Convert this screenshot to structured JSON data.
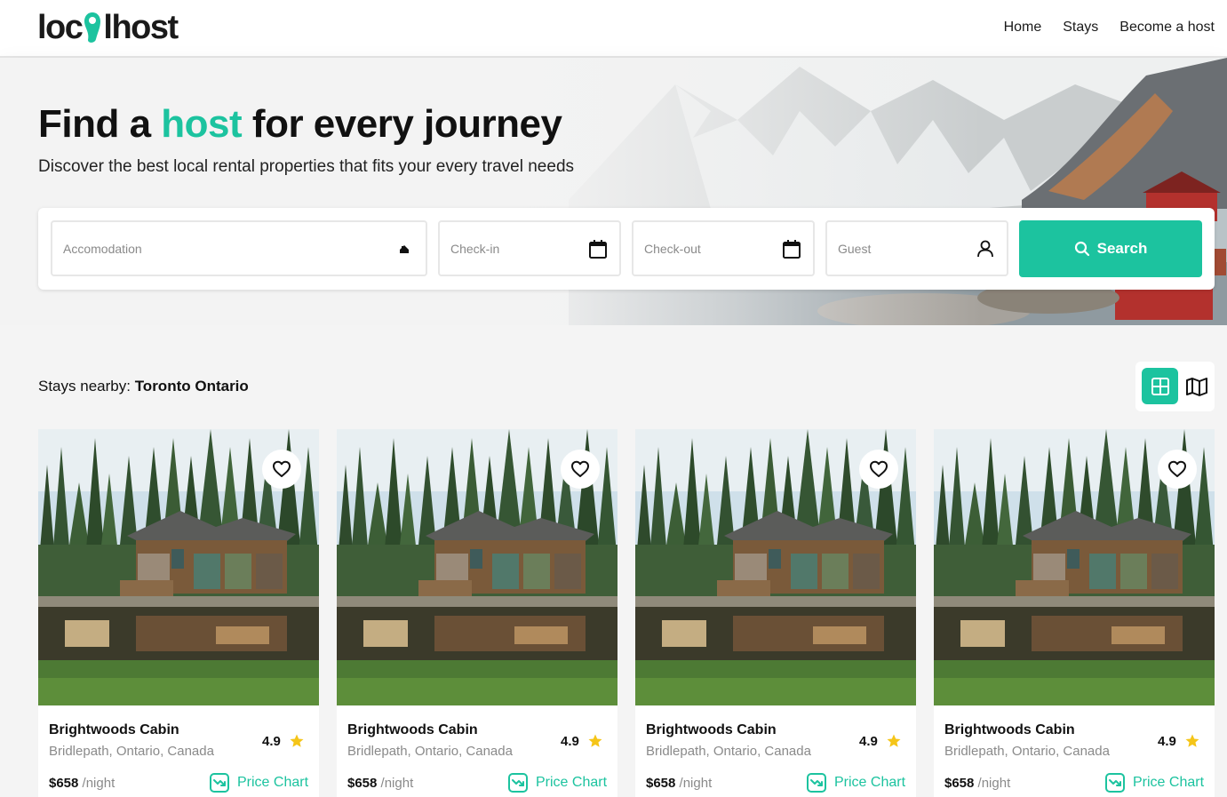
{
  "brand": {
    "logo_text_left": "loc",
    "logo_text_right": "lhost",
    "accent_color": "#1cc39f"
  },
  "nav": {
    "items": [
      {
        "label": "Home"
      },
      {
        "label": "Stays"
      },
      {
        "label": "Become a host"
      }
    ]
  },
  "hero": {
    "headline_pre": "Find a",
    "headline_accent": "host",
    "headline_post": "for every journey",
    "subline": "Discover the best local rental properties that fits your every travel needs"
  },
  "search": {
    "accommodation_placeholder": "Accomodation",
    "checkin_placeholder": "Check-in",
    "checkout_placeholder": "Check-out",
    "guest_placeholder": "Guest",
    "button_label": "Search",
    "icons": {
      "accommodation": "home-icon",
      "checkin": "calendar-icon",
      "checkout": "calendar-icon",
      "guest": "user-icon",
      "button": "search-icon"
    }
  },
  "listing": {
    "nearby_label": "Stays nearby:",
    "nearby_location": "Toronto Ontario",
    "view_toggle": {
      "grid_icon": "grid-icon",
      "map_icon": "map-icon",
      "active": "grid"
    },
    "cards": [
      {
        "name": "Brightwoods Cabin",
        "location": "Bridlepath, Ontario, Canada",
        "rating": "4.9",
        "price": "$658",
        "price_unit": "/night",
        "chart_label": "Price Chart"
      },
      {
        "name": "Brightwoods Cabin",
        "location": "Bridlepath, Ontario, Canada",
        "rating": "4.9",
        "price": "$658",
        "price_unit": "/night",
        "chart_label": "Price Chart"
      },
      {
        "name": "Brightwoods Cabin",
        "location": "Bridlepath, Ontario, Canada",
        "rating": "4.9",
        "price": "$658",
        "price_unit": "/night",
        "chart_label": "Price Chart"
      },
      {
        "name": "Brightwoods Cabin",
        "location": "Bridlepath, Ontario, Canada",
        "rating": "4.9",
        "price": "$658",
        "price_unit": "/night",
        "chart_label": "Price Chart"
      }
    ]
  }
}
